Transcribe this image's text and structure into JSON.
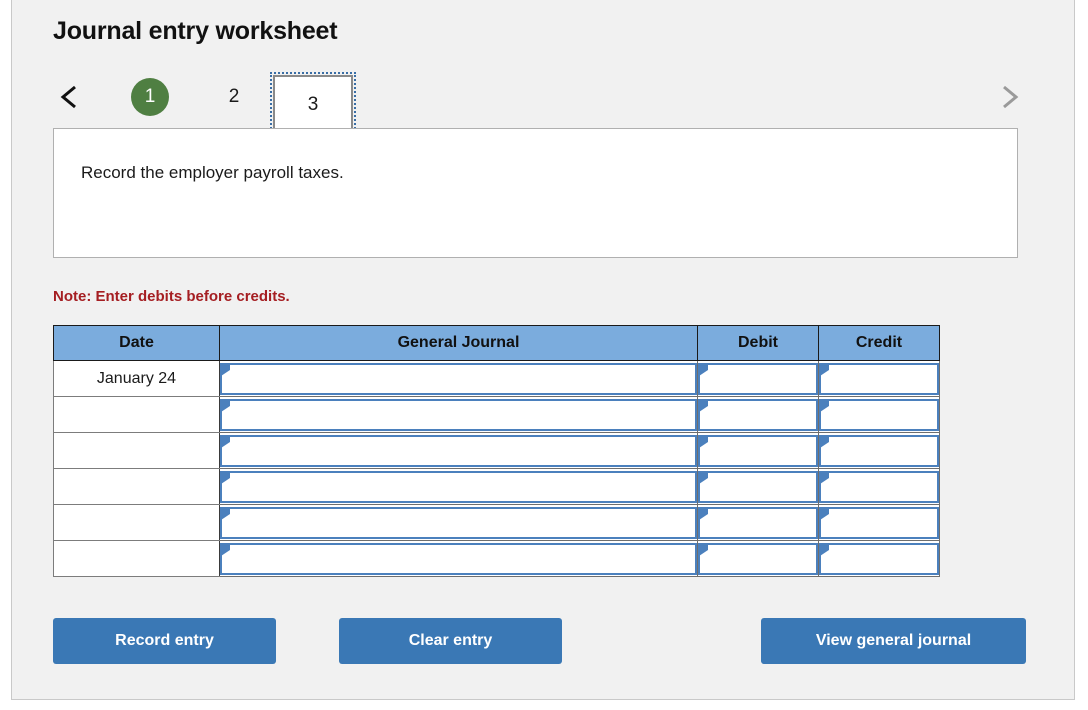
{
  "page": {
    "title": "Journal entry worksheet"
  },
  "pager": {
    "prev_icon": "chevron-left-icon",
    "next_icon": "chevron-right-icon",
    "steps": [
      {
        "label": "1",
        "state": "completed"
      },
      {
        "label": "2",
        "state": "default"
      },
      {
        "label": "3",
        "state": "active"
      }
    ]
  },
  "instruction": {
    "text": "Record the employer payroll taxes."
  },
  "note": {
    "text": "Note: Enter debits before credits."
  },
  "table": {
    "headers": {
      "date": "Date",
      "general_journal": "General Journal",
      "debit": "Debit",
      "credit": "Credit"
    },
    "rows": [
      {
        "date": "January 24",
        "general_journal": "",
        "debit": "",
        "credit": ""
      },
      {
        "date": "",
        "general_journal": "",
        "debit": "",
        "credit": ""
      },
      {
        "date": "",
        "general_journal": "",
        "debit": "",
        "credit": ""
      },
      {
        "date": "",
        "general_journal": "",
        "debit": "",
        "credit": ""
      },
      {
        "date": "",
        "general_journal": "",
        "debit": "",
        "credit": ""
      },
      {
        "date": "",
        "general_journal": "",
        "debit": "",
        "credit": ""
      }
    ]
  },
  "buttons": {
    "record": "Record entry",
    "clear": "Clear entry",
    "view": "View general journal"
  },
  "colors": {
    "accent_blue": "#3a78b5",
    "header_blue": "#7bacdd",
    "input_border_blue": "#4b80bd",
    "step_green": "#4f7f42",
    "note_red": "#a51e22",
    "card_bg": "#f1f1f1"
  }
}
